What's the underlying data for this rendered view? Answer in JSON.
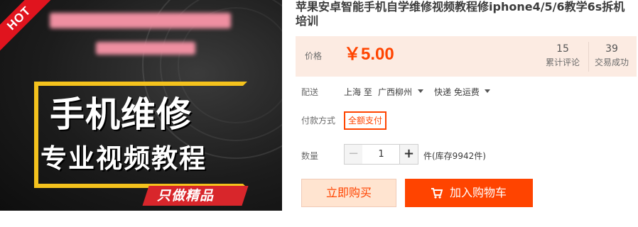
{
  "image": {
    "hot_badge": "HOT",
    "title_main": "手机维修",
    "title_sub": "专业视频教程",
    "slogan": "只做精品"
  },
  "product": {
    "title": "苹果安卓智能手机自学维修视频教程修iphone4/5/6教学6s拆机培训"
  },
  "price": {
    "label": "价格",
    "value": "￥5.00",
    "reviews_count": "15",
    "reviews_label": "累计评论",
    "sales_count": "39",
    "sales_label": "交易成功"
  },
  "shipping": {
    "label": "配送",
    "from": "上海 至",
    "to": "广西柳州",
    "method": "快递 免运费"
  },
  "payment": {
    "label": "付款方式",
    "option": "全额支付"
  },
  "quantity": {
    "label": "数量",
    "minus": "−",
    "value": "1",
    "plus": "+",
    "stock": "件(库存9942件)"
  },
  "actions": {
    "buy_now": "立即购买",
    "add_to_cart": "加入购物车"
  },
  "colors": {
    "accent": "#ff4400",
    "price_bg": "#fcebe2",
    "hot_red": "#e0141e",
    "frame_yellow": "#f4c21d"
  },
  "icons": {
    "cart": "cart-icon",
    "dropdown": "caret-down-icon"
  }
}
